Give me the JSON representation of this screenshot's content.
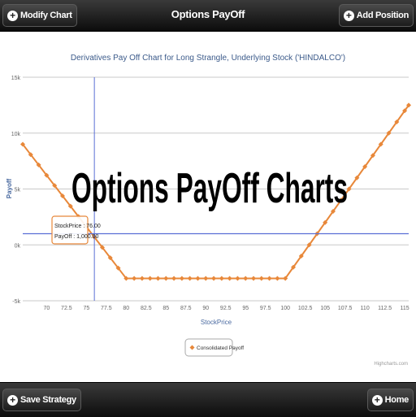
{
  "header": {
    "title": "Options PayOff",
    "left_button": "Modify Chart",
    "right_button": "Add Position"
  },
  "footer": {
    "left_button": "Save Strategy",
    "right_button": "Home"
  },
  "overlay_text": "Options PayOff Charts",
  "credit": "Highcharts.com",
  "tooltip": {
    "line1": "StockPrice : 76.00",
    "line2": "PayOff : 1,000.00"
  },
  "colors": {
    "series": "#e8883a",
    "crosshair": "#5a6fd6"
  },
  "chart_data": {
    "type": "line",
    "title": "Derivatives Pay Off Chart for Long Strangle, Underlying Stock ('HINDALCO')",
    "xlabel": "StockPrice",
    "ylabel": "Payoff",
    "xlim": [
      67,
      115.5
    ],
    "ylim": [
      -5000,
      15000
    ],
    "x_ticks": [
      "70",
      "72.5",
      "75",
      "77.5",
      "80",
      "82.5",
      "85",
      "87.5",
      "90",
      "92.5",
      "95",
      "97.5",
      "100",
      "102.5",
      "105",
      "107.5",
      "110",
      "112.5",
      "115"
    ],
    "y_ticks": [
      {
        "v": -5000,
        "label": "-5k"
      },
      {
        "v": 0,
        "label": "0k"
      },
      {
        "v": 5000,
        "label": "5k"
      },
      {
        "v": 10000,
        "label": "10k"
      },
      {
        "v": 15000,
        "label": "15k"
      }
    ],
    "legend": "bottom-center",
    "crosshair": {
      "x": 76,
      "y": 1000
    },
    "series": [
      {
        "name": "Consolidated Payoff",
        "knots": [
          [
            67,
            9000
          ],
          [
            80,
            -3000
          ],
          [
            100,
            -3000
          ],
          [
            115.5,
            12500
          ]
        ],
        "step": 1
      }
    ]
  }
}
